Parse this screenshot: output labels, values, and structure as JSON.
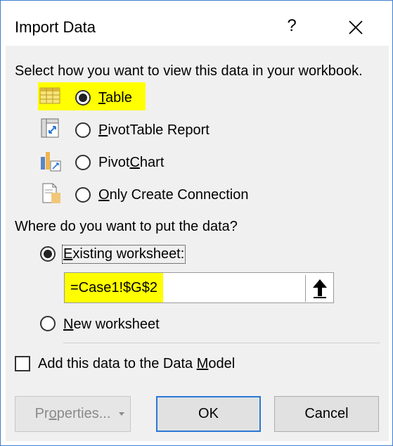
{
  "dialog": {
    "title": "Import Data",
    "help_label": "?",
    "close_icon": "close-icon"
  },
  "view": {
    "prompt": "Select how you want to view this data in your workbook.",
    "options": [
      {
        "pre": "",
        "ul": "T",
        "post": "able",
        "icon": "table-icon",
        "selected": true,
        "highlighted": true
      },
      {
        "pre": "",
        "ul": "P",
        "post": "ivotTable Report",
        "icon": "pivottable-icon",
        "selected": false
      },
      {
        "pre": "Pivot",
        "ul": "C",
        "post": "hart",
        "icon": "pivotchart-icon",
        "selected": false
      },
      {
        "pre": "",
        "ul": "O",
        "post": "nly Create Connection",
        "icon": "connection-icon",
        "selected": false
      }
    ]
  },
  "location": {
    "prompt": "Where do you want to put the data?",
    "existing": {
      "ul": "E",
      "post": "xisting worksheet:",
      "selected": true
    },
    "reference_value": "=Case1!$G$2",
    "collapse_icon": "up-arrow-icon",
    "new": {
      "ul": "N",
      "post": "ew worksheet",
      "selected": false
    }
  },
  "data_model": {
    "pre": "Add this data to the Data ",
    "ul": "M",
    "post": "odel",
    "checked": false
  },
  "buttons": {
    "properties": {
      "pre": "Pr",
      "ul": "o",
      "post": "perties...",
      "disabled": true
    },
    "ok": "OK",
    "cancel": "Cancel"
  },
  "colors": {
    "highlight": "#ffff00",
    "accent": "#2b78d6",
    "border": "#3f7fce"
  }
}
